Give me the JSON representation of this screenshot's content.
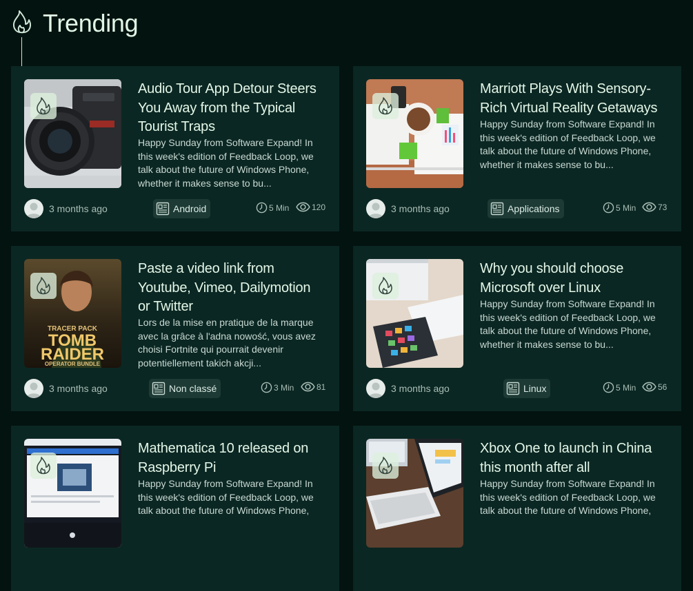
{
  "header": {
    "title": "Trending",
    "icon": "flame-icon"
  },
  "colors": {
    "page_bg": "#03130f",
    "card_bg": "#0b2723",
    "title_text": "#e2f6e7",
    "badge_bg": "#dcf0dc"
  },
  "posts": [
    {
      "title": "Audio Tour App Detour Steers You Away from the Typical Tourist Traps",
      "excerpt": "Happy Sunday from Software Expand! In this week's edition of Feedback Loop, we talk about the future of Windows Phone, whether it makes sense to bu...",
      "time": "3 months ago",
      "category": "Android",
      "read_time": "5 Min",
      "views": "120",
      "image": "camera"
    },
    {
      "title": "Marriott Plays With Sensory-Rich Virtual Reality Getaways",
      "excerpt": "Happy Sunday from Software Expand! In this week's edition of Feedback Loop, we talk about the future of Windows Phone, whether it makes sense to bu...",
      "time": "3 months ago",
      "category": "Applications",
      "read_time": "5 Min",
      "views": "73",
      "image": "desk-coffee"
    },
    {
      "title": "Paste a video link from Youtube, Vimeo, Dailymotion or Twitter",
      "excerpt": "Lors de la mise en pratique de la marque avec la grâce à l'adna nowość, vous avez choisi Fortnite qui pourrait devenir potentiellement takich akcji...",
      "time": "3 months ago",
      "category": "Non classé",
      "read_time": "3 Min",
      "views": "81",
      "image": "tomb-raider",
      "image_text": {
        "top": "TRACER PACK",
        "line1": "TOMB",
        "line2": "RAIDER",
        "bottom": "OPERATOR BUNDLE"
      }
    },
    {
      "title": "Why you should choose Microsoft over Linux",
      "excerpt": "Happy Sunday from Software Expand! In this week's edition of Feedback Loop, we talk about the future of Windows Phone, whether it makes sense to bu...",
      "time": "3 months ago",
      "category": "Linux",
      "read_time": "5 Min",
      "views": "56",
      "image": "tablet-keyboard"
    },
    {
      "title": "Mathematica 10 released on Raspberry Pi",
      "excerpt": "Happy Sunday from Software Expand! In this week's edition of Feedback Loop, we talk about the future of Windows Phone,",
      "image": "monitor"
    },
    {
      "title": "Xbox One to launch in China this month after all",
      "excerpt": "Happy Sunday from Software Expand! In this week's edition of Feedback Loop, we talk about the future of Windows Phone,",
      "image": "laptop"
    }
  ]
}
